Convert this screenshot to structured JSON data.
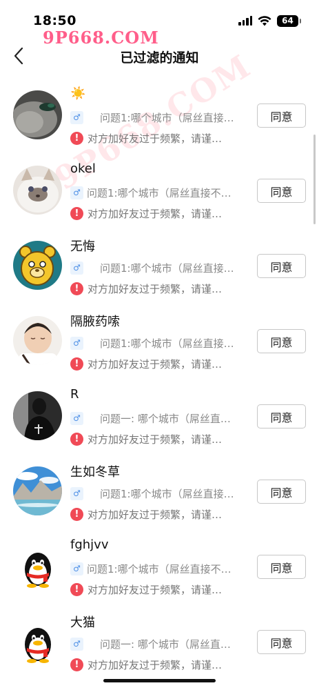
{
  "status_bar": {
    "time": "18:50",
    "battery": "64"
  },
  "watermark": "9P668.COM",
  "watermark_diagonal": "9P668.COM",
  "nav": {
    "title": "已过滤的通知"
  },
  "gender_symbol": "♂",
  "warning_symbol": "!",
  "items": [
    {
      "name": "☀️",
      "question": "问题1:哪个城市（屌丝直接…",
      "reason": "对方加好友过于频繁，请谨…",
      "action": "同意",
      "avatar": "dark-photo",
      "gender_badge_offset": false
    },
    {
      "name": "okel",
      "question": "问题1:哪个城市（屌丝直接不…",
      "reason": "对方加好友过于频繁，请谨…",
      "action": "同意",
      "avatar": "cat",
      "gender_badge_offset": false
    },
    {
      "name": "无悔",
      "question": "问题1:哪个城市（屌丝直接…",
      "reason": "对方加好友过于频繁，请谨…",
      "action": "同意",
      "avatar": "bear",
      "gender_badge_offset": false
    },
    {
      "name": "隔腋药嗦",
      "question": "问题1:哪个城市（屌丝直接…",
      "reason": "对方加好友过于频繁，请谨…",
      "action": "同意",
      "avatar": "baby",
      "gender_badge_offset": false
    },
    {
      "name": "R",
      "question": "问题一: 哪个城市（屌丝直…",
      "reason": "对方加好友过于频繁，请谨…",
      "action": "同意",
      "avatar": "bw-person",
      "gender_badge_offset": false
    },
    {
      "name": "生如冬草",
      "question": "问题1:哪个城市（屌丝直接…",
      "reason": "对方加好友过于频繁，请谨…",
      "action": "同意",
      "avatar": "landscape",
      "gender_badge_offset": false
    },
    {
      "name": "fghjvv",
      "question": "问题1:哪个城市（屌丝直接不…",
      "reason": "对方加好友过于频繁，请谨…",
      "action": "同意",
      "avatar": "penguin",
      "gender_badge_offset": false
    },
    {
      "name": "大猫",
      "question": "问题一: 哪个城市（屌丝直…",
      "reason": "对方加好友过于频繁，请谨…",
      "action": "同意",
      "avatar": "penguin",
      "gender_badge_offset": false
    }
  ]
}
